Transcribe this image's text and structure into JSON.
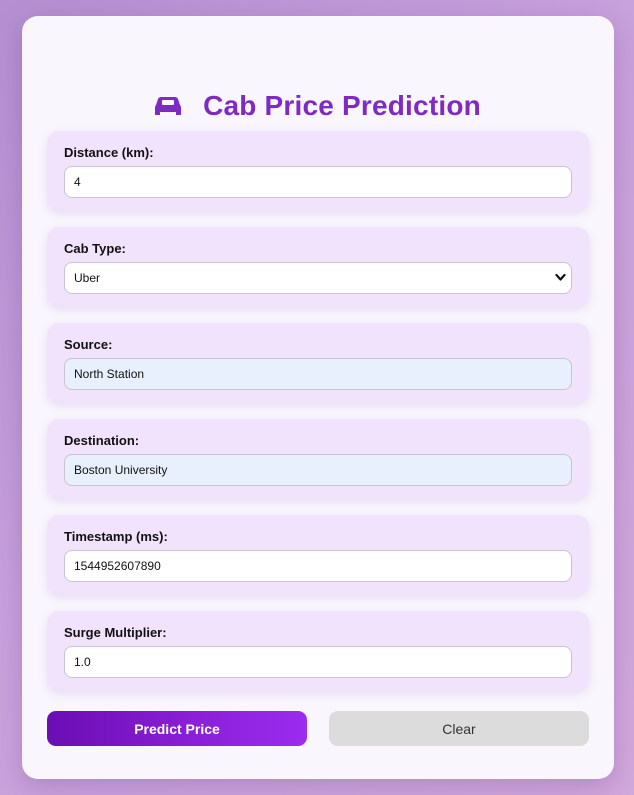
{
  "header": {
    "title": "Cab Price Prediction",
    "icon": "taxi-icon",
    "title_color": "#7e2bc4"
  },
  "form": {
    "distance": {
      "label": "Distance (km):",
      "value": "4"
    },
    "cab_type": {
      "label": "Cab Type:",
      "selected": "Uber",
      "options": [
        "Uber"
      ]
    },
    "source": {
      "label": "Source:",
      "value": "North Station"
    },
    "destination": {
      "label": "Destination:",
      "value": "Boston University"
    },
    "timestamp": {
      "label": "Timestamp (ms):",
      "value": "1544952607890"
    },
    "surge": {
      "label": "Surge Multiplier:",
      "value": "1.0"
    }
  },
  "actions": {
    "predict_label": "Predict Price",
    "clear_label": "Clear",
    "predict_color": "#7e1fd0",
    "clear_color": "#dcdcdc"
  }
}
